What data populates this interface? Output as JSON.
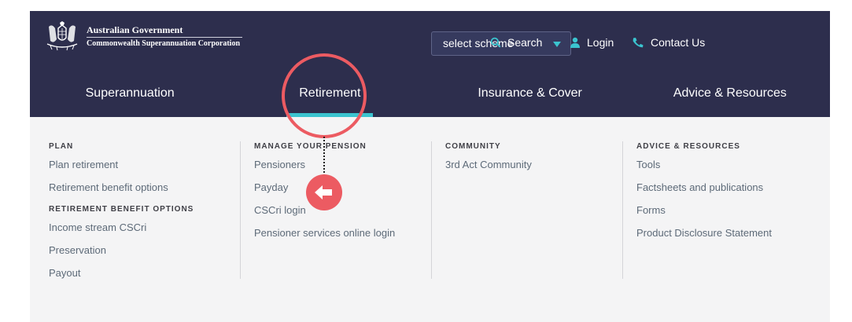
{
  "logo": {
    "line1": "Australian Government",
    "line2": "Commonwealth Superannuation Corporation",
    "icon": "coat-of-arms"
  },
  "scheme_select": {
    "value": "select scheme",
    "icon": "caret-down"
  },
  "toplinks": {
    "search": {
      "label": "Search",
      "icon": "search-icon"
    },
    "login": {
      "label": "Login",
      "icon": "user-icon"
    },
    "contact": {
      "label": "Contact Us",
      "icon": "phone-icon"
    }
  },
  "nav": {
    "items": [
      {
        "label": "Superannuation"
      },
      {
        "label": "Retirement"
      },
      {
        "label": "Insurance & Cover"
      },
      {
        "label": "Advice & Resources"
      }
    ],
    "active_index": 1
  },
  "menu": {
    "plan": {
      "heading": "PLAN",
      "links": [
        "Plan retirement",
        "Retirement benefit options"
      ],
      "subheading": "RETIREMENT BENEFIT OPTIONS",
      "sublinks": [
        "Income stream CSCri",
        "Preservation",
        "Payout"
      ]
    },
    "manage": {
      "heading": "MANAGE YOUR PENSION",
      "links": [
        "Pensioners",
        "Payday",
        "CSCri login",
        "Pensioner services online login"
      ]
    },
    "community": {
      "heading": "COMMUNITY",
      "links": [
        "3rd Act Community"
      ]
    },
    "advice": {
      "heading": "ADVICE & RESOURCES",
      "links": [
        "Tools",
        "Factsheets and publications",
        "Forms",
        "Product Disclosure Statement"
      ]
    }
  },
  "colors": {
    "header_bg": "#2d2e4d",
    "accent": "#3bc4cf",
    "annotation": "#ec5b62",
    "menu_bg": "#f4f4f5"
  }
}
